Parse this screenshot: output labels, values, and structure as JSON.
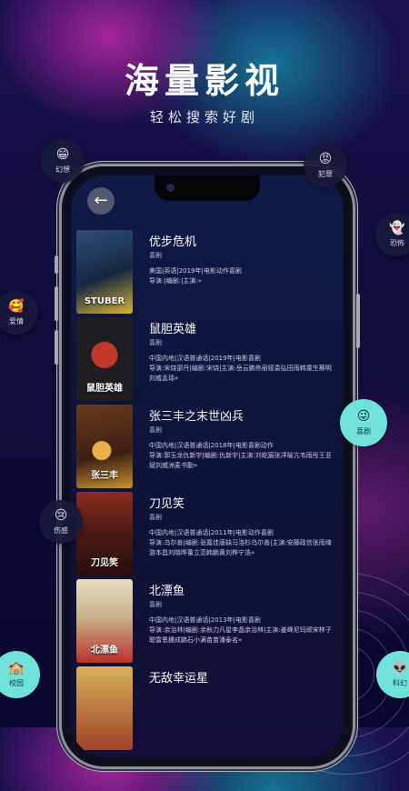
{
  "hero": {
    "title": "海量影视",
    "subtitle": "轻松搜索好剧"
  },
  "back_glyph": "←",
  "categories": [
    {
      "label": "幻想",
      "icon": "😁"
    },
    {
      "label": "犯罪",
      "icon": "😡"
    },
    {
      "label": "恐怖",
      "icon": "👻"
    },
    {
      "label": "爱情",
      "icon": "🥰"
    },
    {
      "label": "喜剧",
      "icon": "😜"
    },
    {
      "label": "伤感",
      "icon": "😢"
    },
    {
      "label": "校园",
      "icon": "🏫"
    },
    {
      "label": "科幻",
      "icon": "👽"
    }
  ],
  "movies": [
    {
      "title": "优步危机",
      "genre": "喜剧",
      "info": "美国|英语|2019年|电影动作喜剧",
      "credits": "导演:|编剧:|主演:»",
      "poster_text": "STUBER",
      "poster_colors": [
        "#2b4f7a",
        "#d8b23a"
      ]
    },
    {
      "title": "鼠胆英雄",
      "genre": "喜剧",
      "info": "中国内地|汉语普通话|2019年|电影喜剧",
      "credits": "导演:宋烧邵丹|编剧:宋烧|主演:岳云鹏佟丽娅袁弘田雨韩童生蔡明刘威孟瑶»",
      "poster_text": "鼠胆英雄",
      "poster_colors": [
        "#2a2a2e",
        "#c0392b"
      ]
    },
    {
      "title": "张三丰之末世凶兵",
      "genre": "喜剧",
      "info": "中国内地|汉语普通话|2018年|电影喜剧动作",
      "credits": "导演:郭玉龙仇新宇|编剧:仇新宇|主演:刘屹宸张洋喻亢韦雨彤王亚斌刘威洲麦书勤»",
      "poster_text": "张三丰",
      "poster_colors": [
        "#6b3a1e",
        "#c8902e"
      ]
    },
    {
      "title": "刀见笑",
      "genre": "喜剧",
      "info": "中国内地|汉语普通话|2011年|电影动作喜剧",
      "credits": "导演:乌尔善|编剧:张嘉佳唐缺马洛杉乌尔善|主演:安藤政信张雨绮游本昌刘晓晔董立范韩鹏黄刘桦宁浩»",
      "poster_text": "刀见笑",
      "poster_colors": [
        "#4a1a14",
        "#b5322a"
      ]
    },
    {
      "title": "北漂鱼",
      "genre": "喜剧",
      "info": "中国内地|汉语普通话|2013年|电影喜剧",
      "credits": "导演:余治林|编剧:余秋力凡星李晶余治林|主演:姜峰尼玛顽宋林子聪雷恩穗成鹏石小满苗苗潘泰名»",
      "poster_text": "北漂鱼",
      "poster_colors": [
        "#c9b28a",
        "#b8312f"
      ]
    },
    {
      "title": "无敌幸运星",
      "genre": "",
      "info": "",
      "credits": "",
      "poster_text": "",
      "poster_colors": [
        "#d6b25a",
        "#a0422a"
      ]
    }
  ],
  "colors": {
    "accent": "#6fe2da",
    "bubble_bg": "#181a3a",
    "screen_bg": "#0d1236"
  }
}
